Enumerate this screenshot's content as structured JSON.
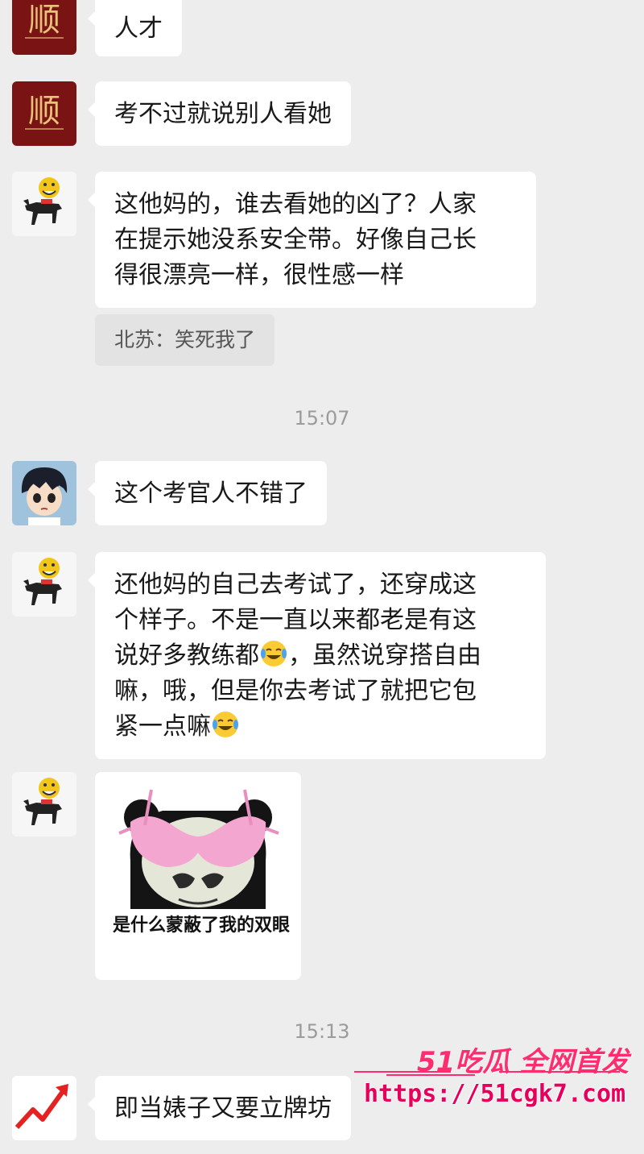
{
  "messages": [
    {
      "sender_avatar": "shun-logo-avatar",
      "lines": [
        "人才"
      ]
    },
    {
      "sender_avatar": "shun-logo-avatar",
      "lines": [
        "考不过就说别人看她"
      ]
    },
    {
      "sender_avatar": "donkey-emoji-avatar",
      "lines": [
        "这他妈的，谁去看她的凶了？人家",
        "在提示她没系安全带。好像自己长",
        "得很漂亮一样，很性感一样"
      ],
      "quote": "北苏：笑死我了"
    },
    {
      "sender_avatar": "anime-boy-avatar",
      "lines": [
        "这个考官人不错了"
      ]
    },
    {
      "sender_avatar": "donkey-emoji-avatar",
      "lines": [
        "还他妈的自己去考试了，还穿成这",
        "个样子。不是一直以来都老是有这",
        "说好多教练都",
        "，虽然说穿搭自由",
        "嘛，哦，但是你去考试了就把它包",
        "紧一点嘛"
      ]
    },
    {
      "sender_avatar": "donkey-emoji-avatar",
      "sticker_caption": "是什么蒙蔽了我的双眼"
    },
    {
      "sender_avatar": "stock-chart-avatar",
      "lines": [
        "即当婊子又要立牌坊"
      ]
    }
  ],
  "timestamps": [
    "15:07",
    "15:13"
  ],
  "avatar_logo_text": "顺",
  "watermark": {
    "title": "51吃瓜 全网首发",
    "url": "https://51cgk7.com"
  },
  "colors": {
    "background": "#ededed",
    "bubble": "#ffffff",
    "quote_bg": "#e3e3e3",
    "watermark": "#ff2d6f"
  }
}
